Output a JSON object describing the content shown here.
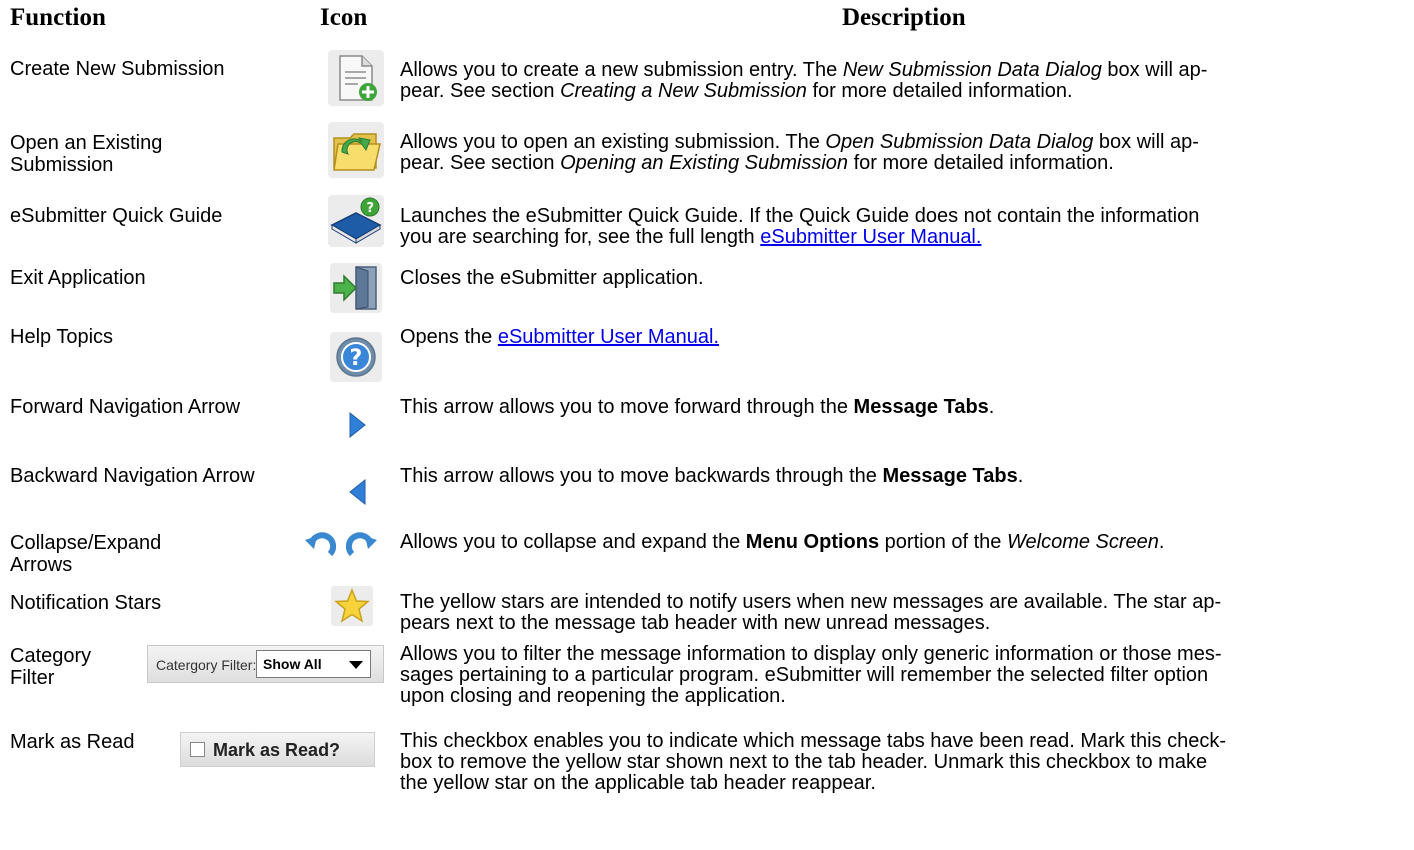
{
  "headers": {
    "function": "Function",
    "icon": "Icon",
    "description": "Description"
  },
  "rows": [
    {
      "function": "Create New Submission",
      "icon": "new-document-icon",
      "desc": {
        "p1": "Allows you to create a new submission entry.  The ",
        "i1": "New Submission Data Dialog",
        "p2": " box will ap-",
        "line2a": "pear.  See section ",
        "i2": "Creating a New Submission",
        "p3": " for more detailed information."
      }
    },
    {
      "function_l1": "Open an Existing",
      "function_l2": "Submission",
      "icon": "open-folder-icon",
      "desc": {
        "p1": "Allows you to open an existing submission.  The ",
        "i1": "Open Submission Data Dialog",
        "p2": " box will ap-",
        "line2a": "pear.  See section ",
        "i2": "Opening an Existing Submission",
        "p3": " for more detailed information."
      }
    },
    {
      "function": "eSubmitter Quick Guide",
      "icon": "help-book-icon",
      "desc": {
        "l1": "Launches the eSubmitter Quick Guide.  If the Quick Guide does not contain the information",
        "l2": "you are searching for, see the full length ",
        "link": "eSubmitter User Manual."
      }
    },
    {
      "function": "Exit Application",
      "icon": "exit-door-icon",
      "desc": {
        "text": "Closes the eSubmitter application."
      }
    },
    {
      "function": "Help Topics",
      "icon": "question-circle-icon",
      "desc": {
        "p1": "Opens the ",
        "link": "eSubmitter User Manual."
      }
    },
    {
      "function": "Forward Navigation Arrow",
      "icon": "arrow-right-icon",
      "desc": {
        "p1": "This arrow allows you to move forward through the ",
        "b1": "Message Tabs",
        "p2": "."
      }
    },
    {
      "function": "Backward Navigation Arrow",
      "icon": "arrow-left-icon",
      "desc": {
        "p1": "This arrow allows you to move backwards through the ",
        "b1": "Message Tabs",
        "p2": "."
      }
    },
    {
      "function_l1": "Collapse/Expand",
      "function_l2": "Arrows",
      "icon": "collapse-expand-icons",
      "desc": {
        "p1": "Allows you to collapse and expand the ",
        "b1": "Menu Options",
        "p2": " portion of the ",
        "i1": "Welcome Screen",
        "p3": "."
      }
    },
    {
      "function": "Notification Stars",
      "icon": "star-icon",
      "desc": {
        "l1": "The yellow stars are intended to notify users when new messages are available.  The star ap-",
        "l2": "pears next to the message tab header with new unread messages."
      }
    },
    {
      "function_l1": "Category",
      "function_l2": "Filter",
      "widget": {
        "label": "Catergory Filter:",
        "value": "Show All"
      },
      "desc": {
        "l1": "Allows you to filter the message information to display only generic information or those mes-",
        "l2": "sages pertaining to a particular program.  eSubmitter will remember the selected filter option",
        "l3": "upon closing and reopening the application."
      }
    },
    {
      "function": "Mark as Read",
      "widget": {
        "label": "Mark as Read?"
      },
      "desc": {
        "l1": "This checkbox enables you to indicate which message tabs have been read.  Mark this check-",
        "l2": "box to remove the yellow star shown next to the tab header.  Unmark this checkbox to make",
        "l3": "the yellow star on the applicable tab header reappear."
      }
    }
  ],
  "colors": {
    "link": "#0000ee",
    "icon_blue": "#2f7fd8",
    "star_yellow": "#f7d23a"
  }
}
